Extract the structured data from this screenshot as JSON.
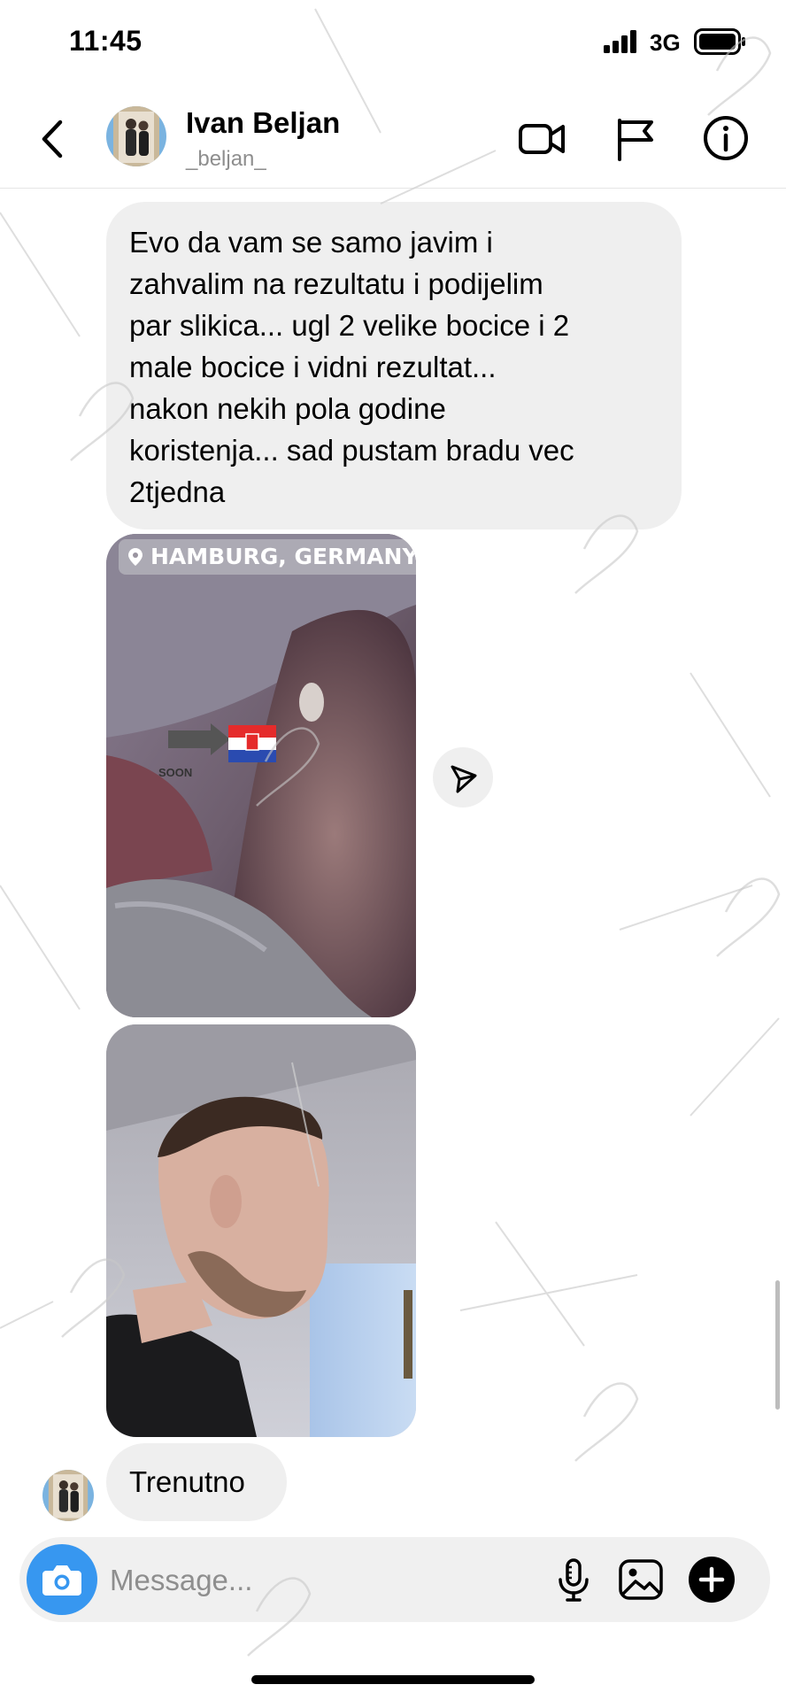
{
  "status_bar": {
    "time": "11:45",
    "network": "3G"
  },
  "header": {
    "name": "Ivan Beljan",
    "username": "_beljan_"
  },
  "thread": {
    "message_1_lines": [
      "Evo da vam se samo javim i",
      "zahvalim na rezultatu i podijelim",
      "par slikica... ugl 2 velike bocice i 2",
      "male bocice i vidni rezultat...",
      "nakon nekih pola godine",
      "koristenja... sad pustam bradu vec",
      "2tjedna"
    ],
    "photo_1": {
      "location_tag": "HAMBURG, GERMANY",
      "sticker_text": "SOON"
    },
    "message_2": "Trenutno"
  },
  "composer": {
    "placeholder": "Message..."
  },
  "colors": {
    "accent": "#3797f0",
    "bubble": "#efefef",
    "secondary_text": "#8e8e8e"
  },
  "icons": {
    "header": [
      "back-chevron-icon",
      "video-call-icon",
      "flag-icon",
      "info-icon"
    ],
    "composer": [
      "camera-icon",
      "microphone-icon",
      "gallery-icon",
      "plus-icon"
    ],
    "other": [
      "share-icon",
      "location-pin-icon"
    ]
  }
}
